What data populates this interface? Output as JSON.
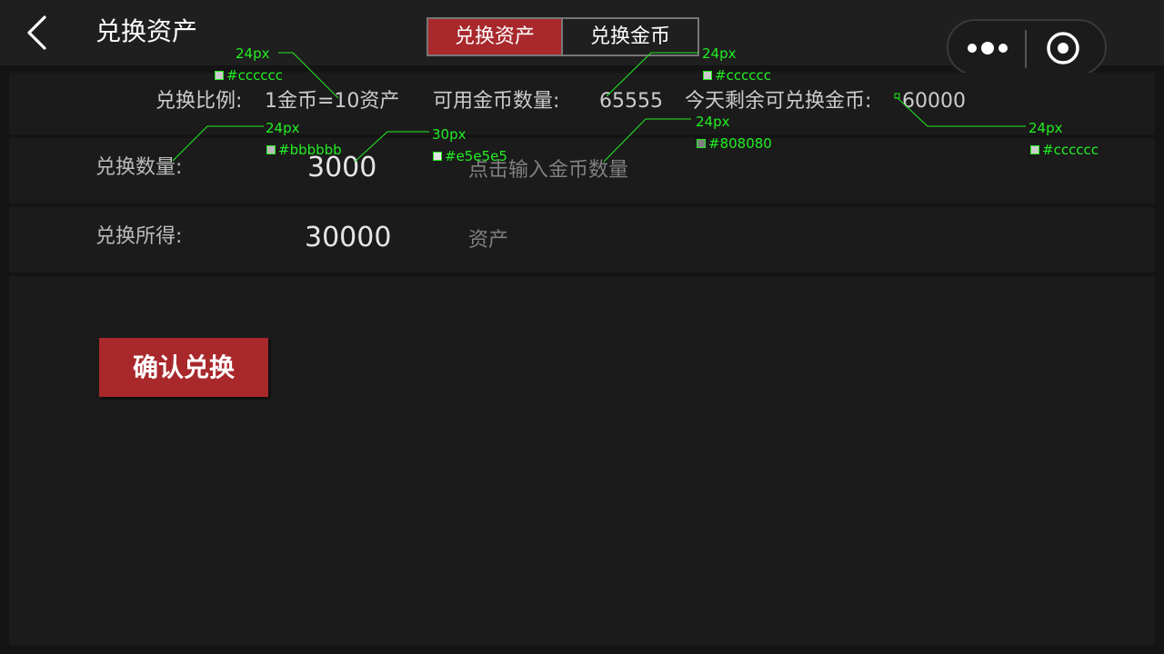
{
  "header": {
    "title": "兑换资产",
    "tabs": [
      {
        "label": "兑换资产",
        "active": true
      },
      {
        "label": "兑换金币",
        "active": false
      }
    ],
    "icons": [
      "back-arrow-icon",
      "more-dots-icon",
      "target-icon"
    ]
  },
  "info": {
    "ratio_label": "兑换比例:",
    "ratio_value": "1金币=10资产",
    "available_label": "可用金币数量:",
    "available_value": "65555",
    "remaining_label": "今天剩余可兑换金币:",
    "remaining_value": "60000"
  },
  "form": {
    "amount_label": "兑换数量:",
    "amount_value": "3000",
    "amount_placeholder": "点击输入金币数量",
    "result_label": "兑换所得:",
    "result_value": "30000",
    "result_unit": "资产"
  },
  "confirm_label": "确认兑换",
  "annotations": [
    {
      "size": "24px",
      "color": "#cccccc"
    },
    {
      "size": "24px",
      "color": "#cccccc"
    },
    {
      "size": "24px",
      "color": "#cccccc"
    },
    {
      "size": "24px",
      "color": "#bbbbbb"
    },
    {
      "size": "30px",
      "color": "#e5e5e5"
    },
    {
      "size": "24px",
      "color": "#808080"
    }
  ],
  "colors": {
    "accent": "#a8282c",
    "background": "#141414",
    "panel": "#1b1b1b",
    "annotation": "#22ee22"
  }
}
